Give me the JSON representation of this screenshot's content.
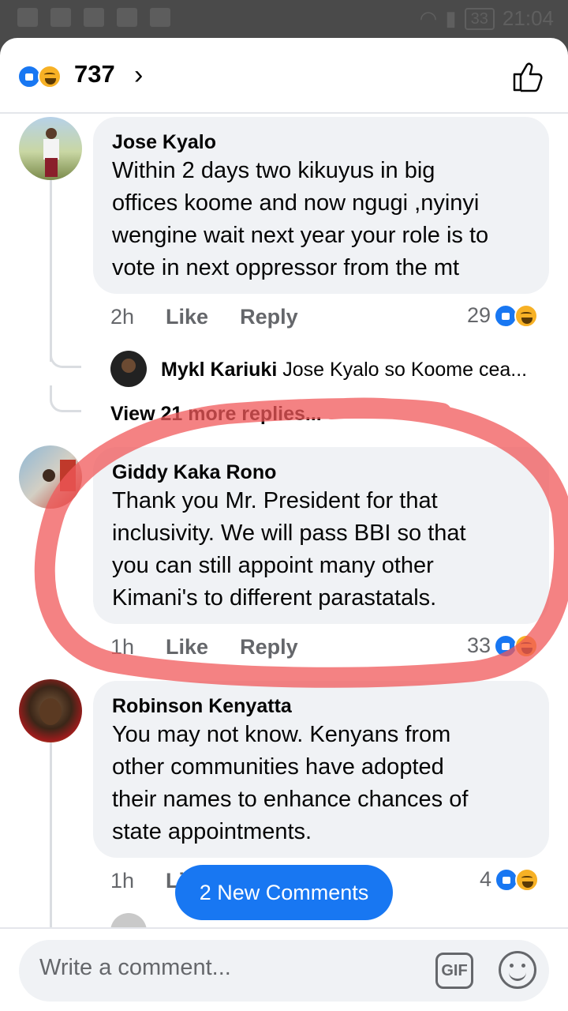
{
  "status_bar": {
    "battery": "33",
    "time": "21:04"
  },
  "header": {
    "reaction_count": "737",
    "chevron": "›"
  },
  "comments": [
    {
      "author": "Jose Kyalo",
      "lines": [
        "Within 2 days two kikuyus in big",
        "offices koome and now ngugi ,nyinyi",
        "wengine wait next year your role is to",
        "vote in next oppressor from the mt"
      ],
      "time": "2h",
      "like": "Like",
      "reply": "Reply",
      "reactions": "29",
      "replies": [
        {
          "author": "Mykl Kariuki",
          "text": "Jose Kyalo so Koome cea..."
        }
      ],
      "view_more": "View 21 more replies..."
    },
    {
      "author": "Giddy Kaka Rono",
      "lines": [
        "Thank you Mr. President for that",
        "inclusivity. We will pass BBI so that",
        "you can still appoint many other",
        "Kimani's to different parastatals."
      ],
      "time": "1h",
      "like": "Like",
      "reply": "Reply",
      "reactions": "33"
    },
    {
      "author": "Robinson Kenyatta",
      "lines": [
        "You may not know. Kenyans from",
        "other communities have adopted",
        "their names to enhance chances of",
        "state appointments."
      ],
      "time": "1h",
      "like": "Li",
      "reactions": "4"
    }
  ],
  "new_comments_label": "2 New Comments",
  "composer": {
    "placeholder": "Write a comment...",
    "gif": "GIF"
  },
  "colors": {
    "brand": "#1877f2",
    "bubble": "#f0f2f5",
    "annotation": "#f0585a"
  }
}
